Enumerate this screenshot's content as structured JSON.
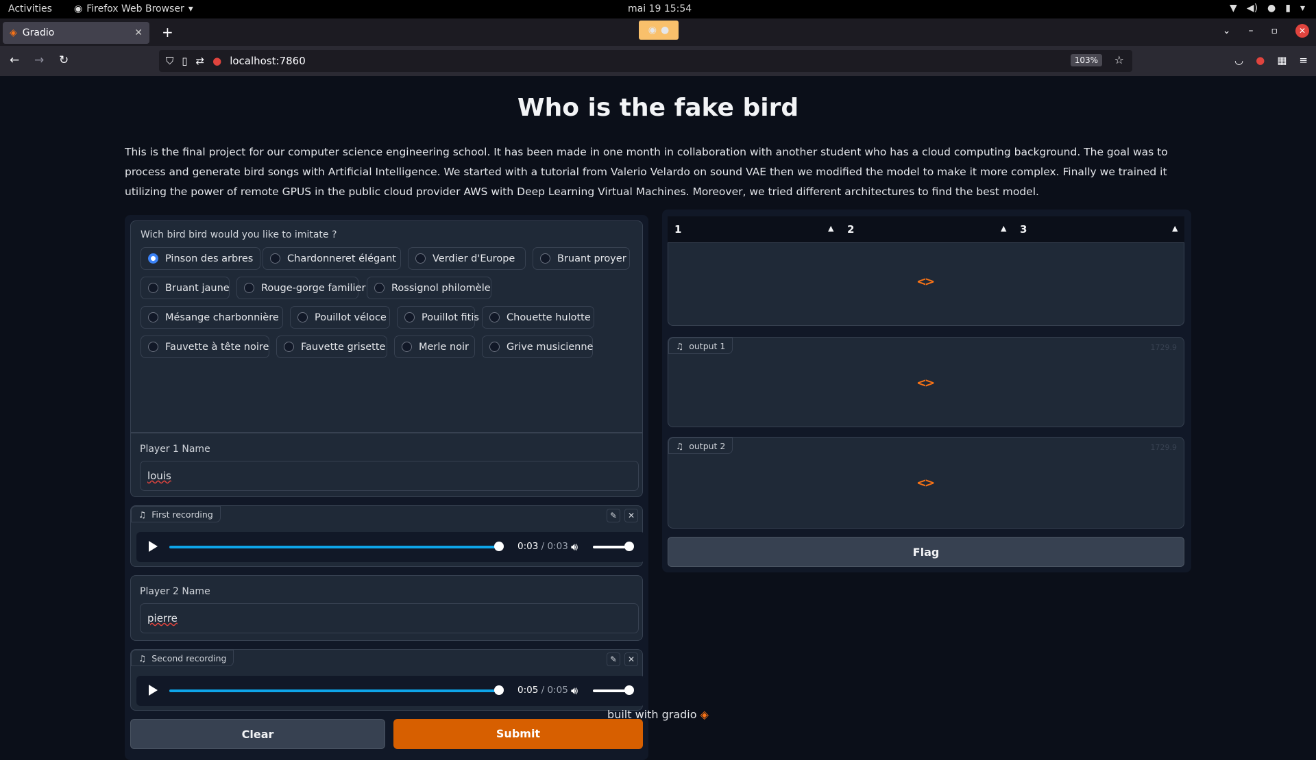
{
  "os_topbar": {
    "activities": "Activities",
    "app_name": "Firefox Web Browser",
    "clock": "mai 19  15:54"
  },
  "browser": {
    "tab_title": "Gradio",
    "url": "localhost:7860",
    "zoom": "103%"
  },
  "page": {
    "title": "Who is the fake bird",
    "description": "This is the final project for our computer science engineering school. It has been made in one month in collaboration with another student who has a cloud computing background. The goal was to process and generate bird songs with Artificial Intelligence. We started with a tutorial from Valerio Velardo on sound VAE then we modified the model to make it more complex. Finally we trained it utilizing the power of remote GPUS in the public cloud provider AWS with Deep Learning Virtual Machines. Moreover, we tried different architectures to find the best model."
  },
  "bird_select": {
    "label": "Wich bird bird would you like to imitate ?",
    "selected": "Pinson des arbres",
    "options": [
      "Pinson des arbres",
      "Chardonneret élégant",
      "Verdier d'Europe",
      "Bruant proyer",
      "Bruant jaune",
      "Rouge-gorge familier",
      "Rossignol philomèle",
      "Mésange charbonnière",
      "Pouillot véloce",
      "Pouillot fitis",
      "Chouette hulotte",
      "Fauvette à tête noire",
      "Fauvette grisette",
      "Merle noir",
      "Grive musicienne"
    ]
  },
  "player1": {
    "label": "Player 1 Name",
    "value": "louis"
  },
  "recording1": {
    "label": "First recording",
    "current": "0:03",
    "sep": " / ",
    "total": "0:03",
    "progress": 1.0
  },
  "player2": {
    "label": "Player 2 Name",
    "value": "pierre"
  },
  "recording2": {
    "label": "Second recording",
    "current": "0:05",
    "sep": " / ",
    "total": "0:05",
    "progress": 1.0
  },
  "buttons": {
    "clear": "Clear",
    "submit": "Submit",
    "flag": "Flag"
  },
  "output_tabs": [
    "1",
    "2",
    "3"
  ],
  "outputs": {
    "output1": {
      "label": "output 1",
      "faint": "1729.9"
    },
    "output2": {
      "label": "output 2",
      "faint": "1729.9"
    }
  },
  "footer": {
    "text": "built with gradio"
  },
  "colors": {
    "accent": "#d75f00",
    "radio_selected": "#3b82f6",
    "progress": "#0ea5e9"
  }
}
